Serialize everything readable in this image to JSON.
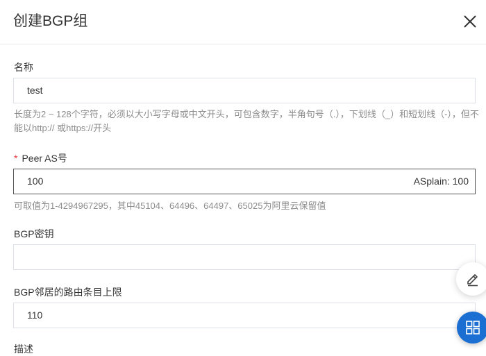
{
  "dialog": {
    "title": "创建BGP组"
  },
  "fields": {
    "name": {
      "label": "名称",
      "value": "test",
      "help": "长度为2 ~ 128个字符，必须以大小写字母或中文开头，可包含数字，半角句号（.），下划线（_）和短划线（-），但不能以http:// 或https://开头"
    },
    "peer_as": {
      "required_mark": "*",
      "label": "Peer AS号",
      "value": "100",
      "suffix": "ASplain: 100",
      "help": "可取值为1-4294967295，其中45104、64496、64497、65025为阿里云保留值"
    },
    "bgp_key": {
      "label": "BGP密钥",
      "value": ""
    },
    "route_limit": {
      "label": "BGP邻居的路由条目上限",
      "value": "110"
    },
    "description": {
      "label": "描述"
    }
  },
  "colors": {
    "accent": "#1b6fd3",
    "required": "#e4393c",
    "help_text": "#8c8c8c"
  },
  "icons": {
    "close": "close-icon",
    "edit": "edit-icon",
    "apps": "apps-grid-icon"
  }
}
